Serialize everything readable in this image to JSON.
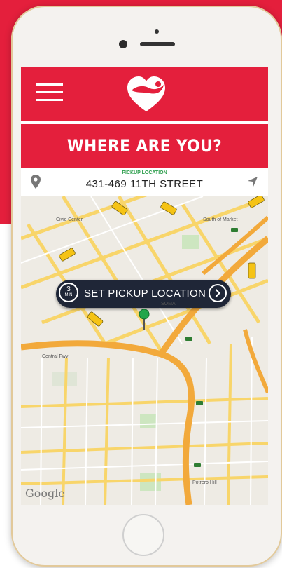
{
  "colors": {
    "brand_red": "#e41f3c",
    "header_text": "#ffffff",
    "location_label_green": "#2a9d4a",
    "pill_dark": "#1f2637",
    "map_road_yellow": "#f8d56a",
    "map_highway_orange": "#f2a93b"
  },
  "header": {
    "menu_icon": "hamburger-menu-icon",
    "logo_icon": "heart-logo-icon"
  },
  "title": "WHERE ARE YOU?",
  "location_bar": {
    "label": "PICKUP LOCATION",
    "address": "431-469 11TH STREET",
    "left_icon": "location-pin-icon",
    "right_icon": "navigation-arrow-icon"
  },
  "pickup": {
    "eta_value": "3",
    "eta_unit": "MIN",
    "button_label": "SET PICKUP LOCATION",
    "go_icon": "chevron-right-circle-icon"
  },
  "map": {
    "attribution": "Google",
    "street_labels": [
      "Civic Center",
      "South of Market",
      "Central Fwy",
      "Potrero Hill",
      "SOMA"
    ]
  }
}
